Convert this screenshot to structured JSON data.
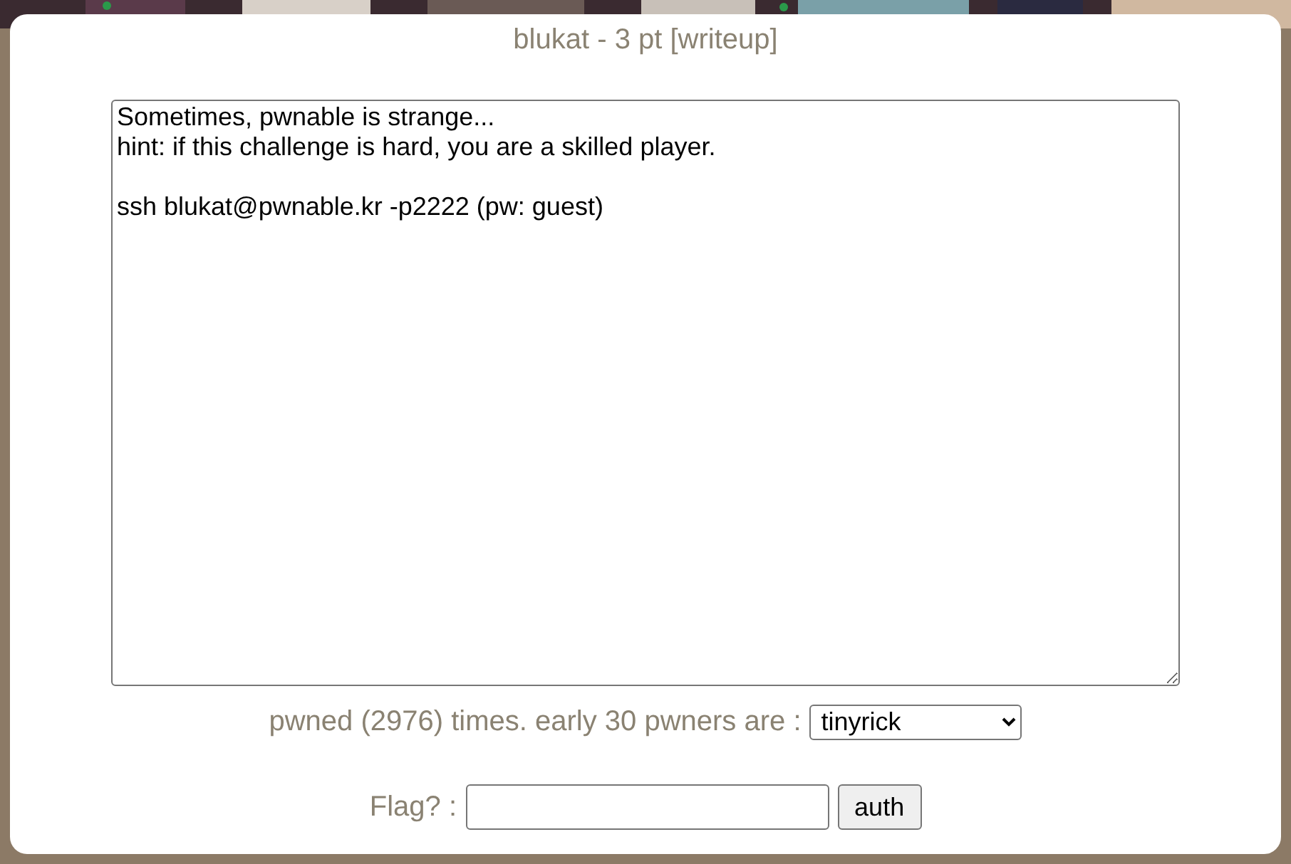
{
  "title": "blukat - 3 pt [writeup]",
  "description": {
    "value": "Sometimes, pwnable is strange...\nhint: if this challenge is hard, you are a skilled player.\n\nssh blukat@pwnable.kr -p2222 (pw: guest)"
  },
  "pwners": {
    "label": "pwned (2976) times. early 30 pwners are :",
    "selected_value": "tinyrick"
  },
  "flag": {
    "label": "Flag? :",
    "button": "auth"
  }
}
